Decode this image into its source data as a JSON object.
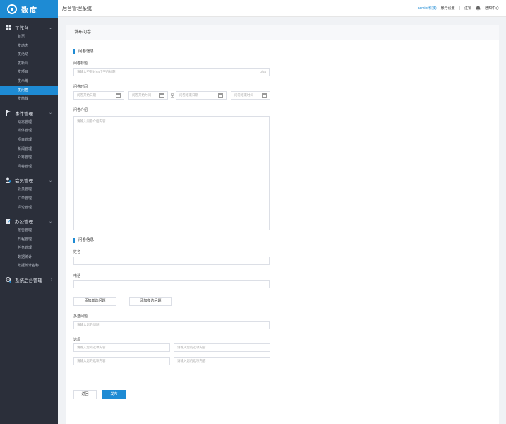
{
  "logo": {
    "text": "数度"
  },
  "topbar": {
    "title": "后台管理系统",
    "user": "admin(科技)",
    "account_settings": "账号设置",
    "logout": "注销",
    "notify": "通知中心",
    "separator": "|"
  },
  "sidebar": {
    "groups": [
      {
        "label": "工作台",
        "icon": "dashboard-icon",
        "items": [
          "首页",
          "发动态",
          "发活动",
          "发新闻",
          "发项目",
          "发众筹",
          "发问卷",
          "发简故"
        ]
      },
      {
        "label": "事件管理",
        "icon": "flag-icon",
        "items": [
          "动态管理",
          "媒体管理",
          "项目管理",
          "新闻管理",
          "众筹管理",
          "问卷管理"
        ]
      },
      {
        "label": "会员管理",
        "icon": "users-icon",
        "items": [
          "会员管理",
          "订单管理",
          "评论管理"
        ]
      },
      {
        "label": "办公管理",
        "icon": "edit-icon",
        "items": [
          "报告管理",
          "日程管理",
          "任务管理",
          "数据统计",
          "数据统计名称"
        ]
      },
      {
        "label": "系统后台管理",
        "icon": "gear-icon",
        "items": []
      }
    ],
    "active_item": "发问卷"
  },
  "panel": {
    "title": "发布问卷",
    "section1_title": "问卷信息",
    "q_title_label": "问卷标题",
    "q_title_placeholder": "请输入不超过64个字的标题",
    "q_title_count": "0/64",
    "q_time_label": "问卷时间",
    "start_date_placeholder": "问卷开始日期",
    "start_time_placeholder": "问卷开始时间",
    "range_sep": "至",
    "end_date_placeholder": "问卷结束日期",
    "end_time_placeholder": "问卷结束时间",
    "intro_label": "问卷介绍",
    "intro_placeholder": "请输入问卷介绍内容",
    "section2_title": "问卷信息",
    "name_label": "姓名",
    "phone_label": "电话",
    "add_single_btn": "添加单选问题",
    "add_multi_btn": "添加多选问题",
    "multi_label": "多选问题",
    "multi_placeholder": "请输入您的问题",
    "options_label": "选项",
    "option_placeholder": "请输入您的选项内容",
    "back_btn": "返回",
    "publish_btn": "发布"
  }
}
